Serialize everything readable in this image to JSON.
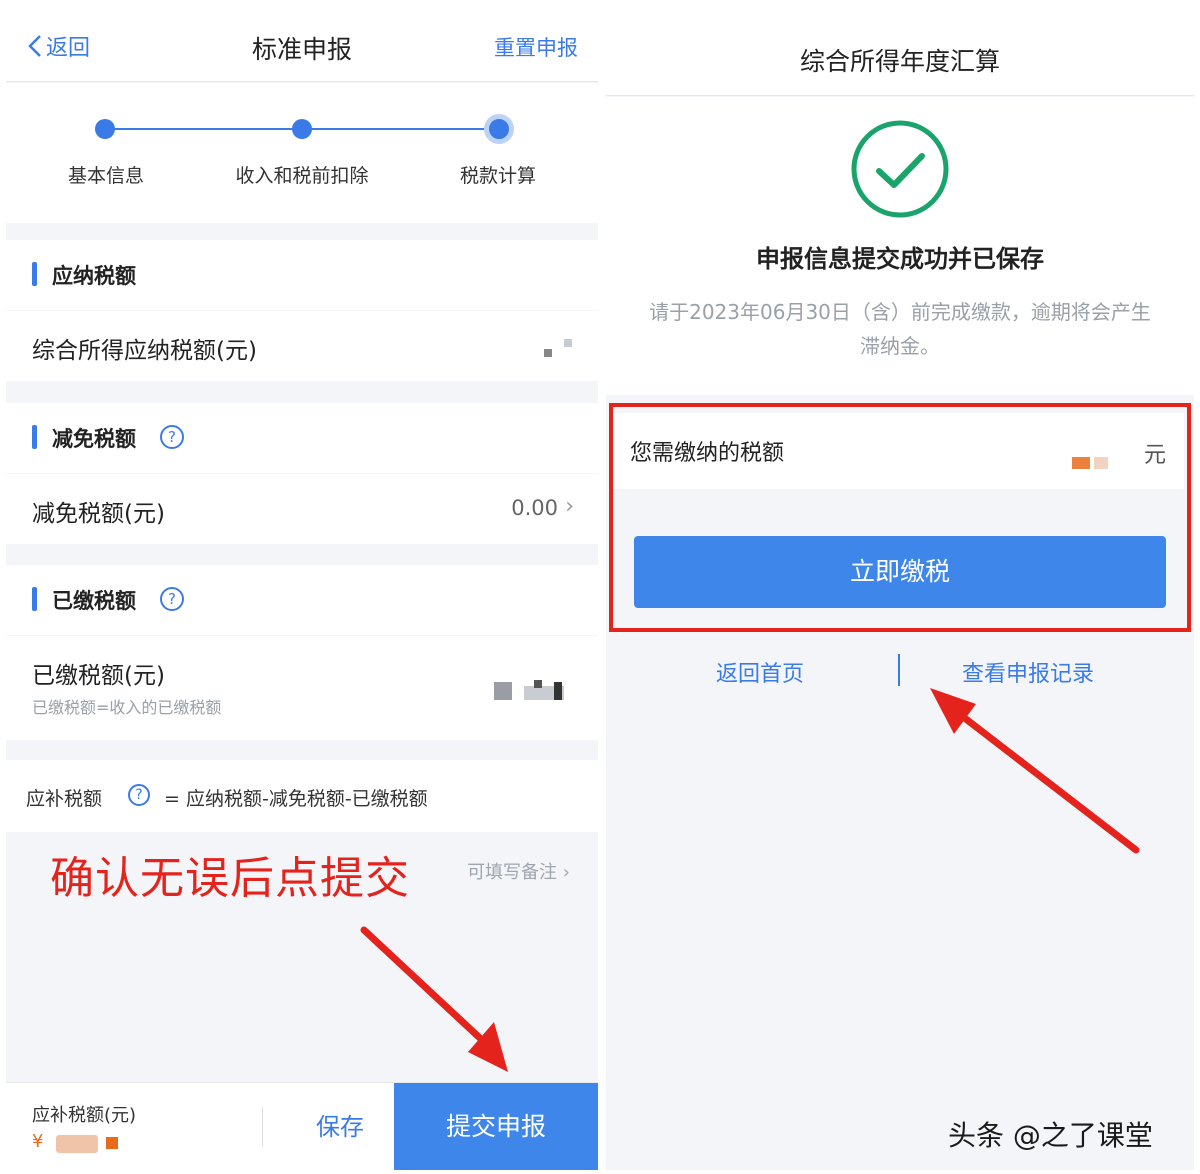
{
  "left": {
    "header": {
      "back_label": "返回",
      "title": "标准申报",
      "reset_label": "重置申报"
    },
    "steps": [
      {
        "label": "基本信息"
      },
      {
        "label": "收入和税前扣除"
      },
      {
        "label": "税款计算"
      }
    ],
    "payable": {
      "heading": "应纳税额",
      "row_label": "综合所得应纳税额(元)"
    },
    "reduction": {
      "heading": "减免税额",
      "row_label": "减免税额(元)",
      "row_value": "0.00"
    },
    "paid": {
      "heading": "已缴税额",
      "row_label": "已缴税额(元)",
      "row_sub": "已缴税额=收入的已缴税额"
    },
    "formula": {
      "label": "应补税额",
      "expr": "= 应纳税额-减免税额-已缴税额"
    },
    "note_hint": "可填写备注",
    "annotation": "确认无误后点提交",
    "bottom": {
      "due_label": "应补税额(元)",
      "currency": "¥",
      "save_label": "保存",
      "submit_label": "提交申报"
    }
  },
  "right": {
    "header": {
      "title": "综合所得年度汇算"
    },
    "success": {
      "title": "申报信息提交成功并已保存",
      "desc": "请于2023年06月30日（含）前完成缴款，逾期将会产生滞纳金。"
    },
    "pay": {
      "label": "您需缴纳的税额",
      "unit": "元",
      "button": "立即缴税"
    },
    "links": {
      "home": "返回首页",
      "records": "查看申报记录"
    }
  },
  "watermark": "头条 @之了课堂",
  "colors": {
    "accent": "#3b7be8",
    "button": "#3f86ea",
    "annotation": "#e5231d",
    "success": "#1aa36b"
  },
  "icons": [
    "chevron-left-icon",
    "question-icon",
    "chevron-right-icon",
    "check-circle-icon",
    "arrow-annotation-icon"
  ]
}
